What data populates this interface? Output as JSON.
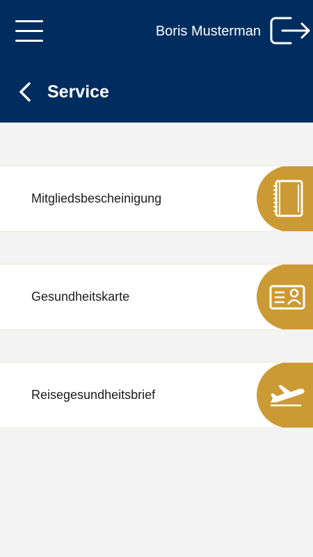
{
  "header": {
    "user_name": "Boris Musterman",
    "title": "Service"
  },
  "services": [
    {
      "label": "Mitgliedsbescheinigung",
      "icon": "notebook-icon"
    },
    {
      "label": "Gesundheitskarte",
      "icon": "id-card-icon"
    },
    {
      "label": "Reisegesundheitsbrief",
      "icon": "airplane-icon"
    }
  ],
  "colors": {
    "header_bg": "#002d5f",
    "accent": "#cc9a35",
    "page_bg": "#f3f3f3",
    "card_bg": "#ffffff"
  }
}
